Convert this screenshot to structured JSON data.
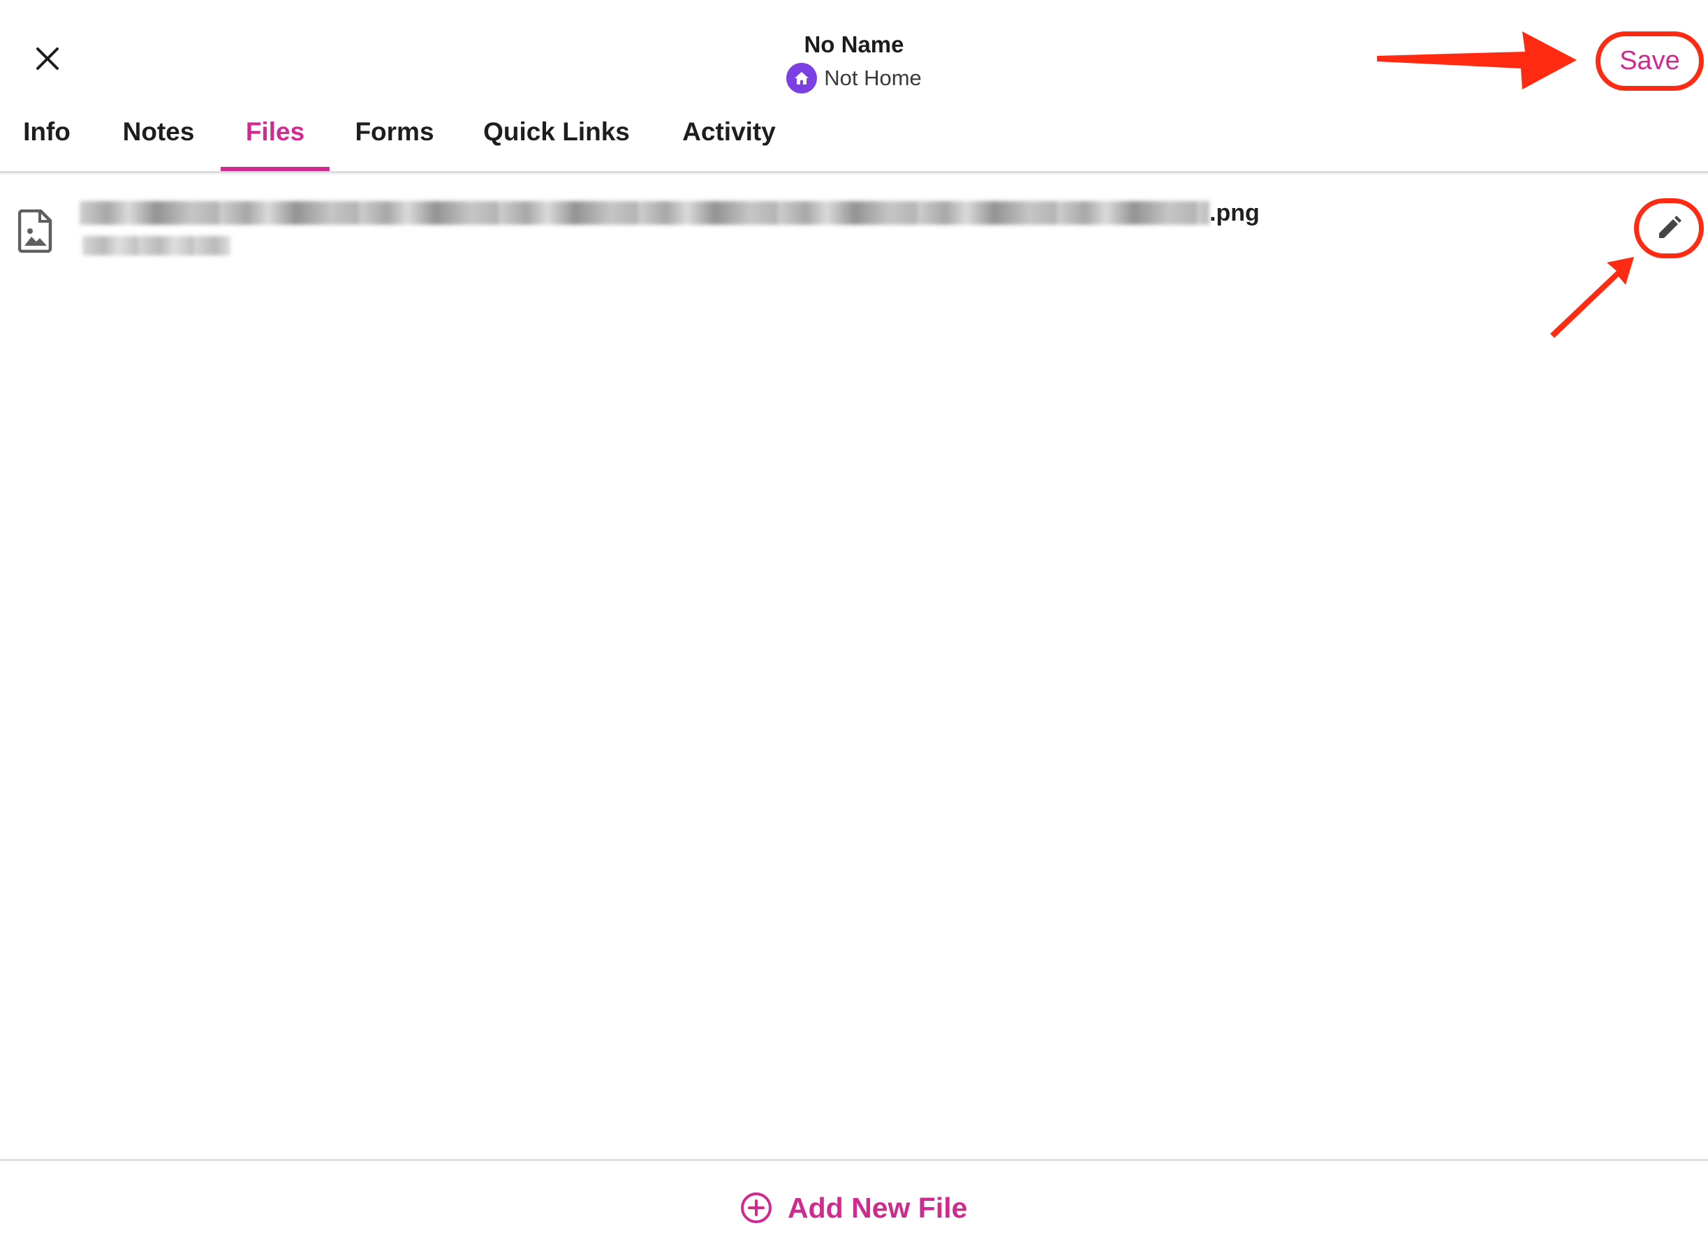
{
  "header": {
    "title": "No Name",
    "status": "Not Home",
    "save_label": "Save"
  },
  "tabs": [
    {
      "label": "Info",
      "active": false
    },
    {
      "label": "Notes",
      "active": false
    },
    {
      "label": "Files",
      "active": true
    },
    {
      "label": "Forms",
      "active": false
    },
    {
      "label": "Quick Links",
      "active": false
    },
    {
      "label": "Activity",
      "active": false
    }
  ],
  "files": [
    {
      "extension": ".png",
      "icon": "image-file-icon"
    }
  ],
  "footer": {
    "add_label": "Add New File"
  },
  "colors": {
    "accent": "#d12a8f",
    "status_badge": "#7b3fe4",
    "annotation": "#ff2a12",
    "text": "#1e1e1e"
  },
  "icons": {
    "close": "close-icon",
    "status": "home-icon",
    "file": "image-file-icon",
    "edit": "pencil-icon",
    "add": "plus-circle-icon"
  }
}
